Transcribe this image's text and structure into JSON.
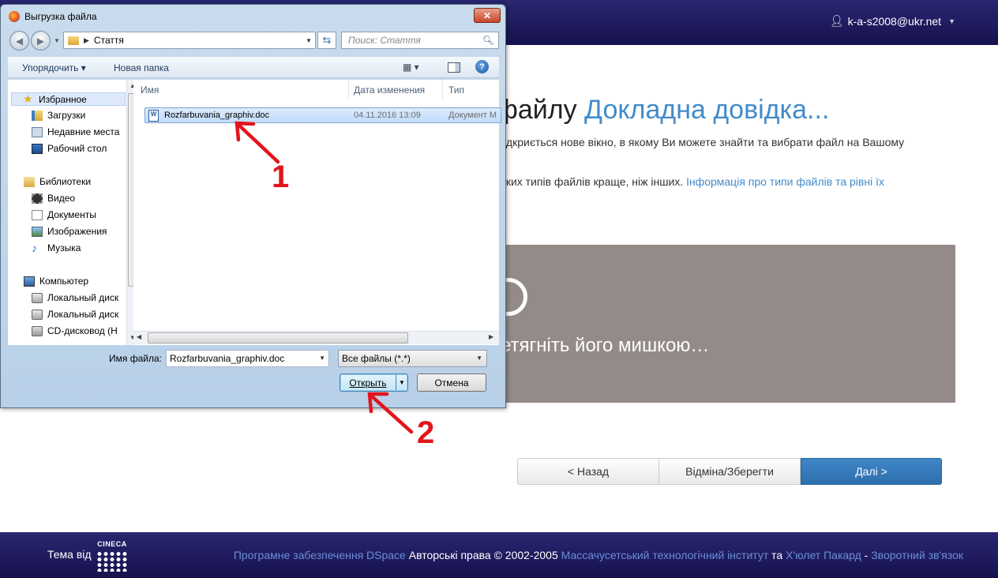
{
  "header": {
    "user_email": "k-a-s2008@ukr.net"
  },
  "main": {
    "heading_prefix": "я файлу ",
    "heading_link": "Докладна довідка...",
    "para1": "“, то відкриється нове вікно, в якому Ви можете знайти та вибрати файл на Вашому",
    "para2_text": "ст деяких типів файлів краще, ніж інших. ",
    "para2_link": "Інформація про типи файлів та рівні їх",
    "dropzone_text": "етягніть його мишкою…",
    "buttons": {
      "back": "< Назад",
      "cancel": "Відміна/Зберегти",
      "next": "Далі >"
    }
  },
  "footer": {
    "theme_label": "Тема від",
    "logo_text": "CINECA",
    "link_dspace": "Програмне забезпечення DSpace",
    "copyright": " Авторські права © 2002-2005 ",
    "link_mit": "Массачусетський технологічний інститут",
    "and": " та ",
    "link_hp": "Х'юлет Пакард",
    "dash": " - ",
    "link_feedback": "Зворотний зв'язок"
  },
  "dialog": {
    "title": "Выгрузка файла",
    "close": "✕",
    "address_folder": "Стаття",
    "search_placeholder": "Поиск: Стаття",
    "toolbar": {
      "organize": "Упорядочить ▾",
      "new_folder": "Новая папка",
      "views": "▦ ▾",
      "help": "?"
    },
    "nav": {
      "favorites": "Избранное",
      "downloads": "Загрузки",
      "recent": "Недавние места",
      "desktop": "Рабочий стол",
      "libraries": "Библиотеки",
      "video": "Видео",
      "documents": "Документы",
      "images": "Изображения",
      "music": "Музыка",
      "computer": "Компьютер",
      "disk1": "Локальный диск",
      "disk2": "Локальный диск",
      "cdrom": "CD-дисковод (H"
    },
    "columns": {
      "name": "Имя",
      "date": "Дата изменения",
      "type": "Тип"
    },
    "files": [
      {
        "name": "Rozfarbuvania_graphiv.doc",
        "date": "04.11.2016 13:09",
        "type": "Документ M"
      }
    ],
    "filename_label": "Имя файла:",
    "filename_value": "Rozfarbuvania_graphiv.doc",
    "filetype_value": "Все файлы (*.*)",
    "open_button": "Открыть",
    "cancel_button": "Отмена"
  },
  "annotations": {
    "step1": "1",
    "step2": "2",
    "color": "#e2151b"
  },
  "colors": {
    "header_bg": "#1e1a5e",
    "link": "#428bca",
    "dropzone": "#948b89",
    "next_btn": "#3378bb"
  }
}
